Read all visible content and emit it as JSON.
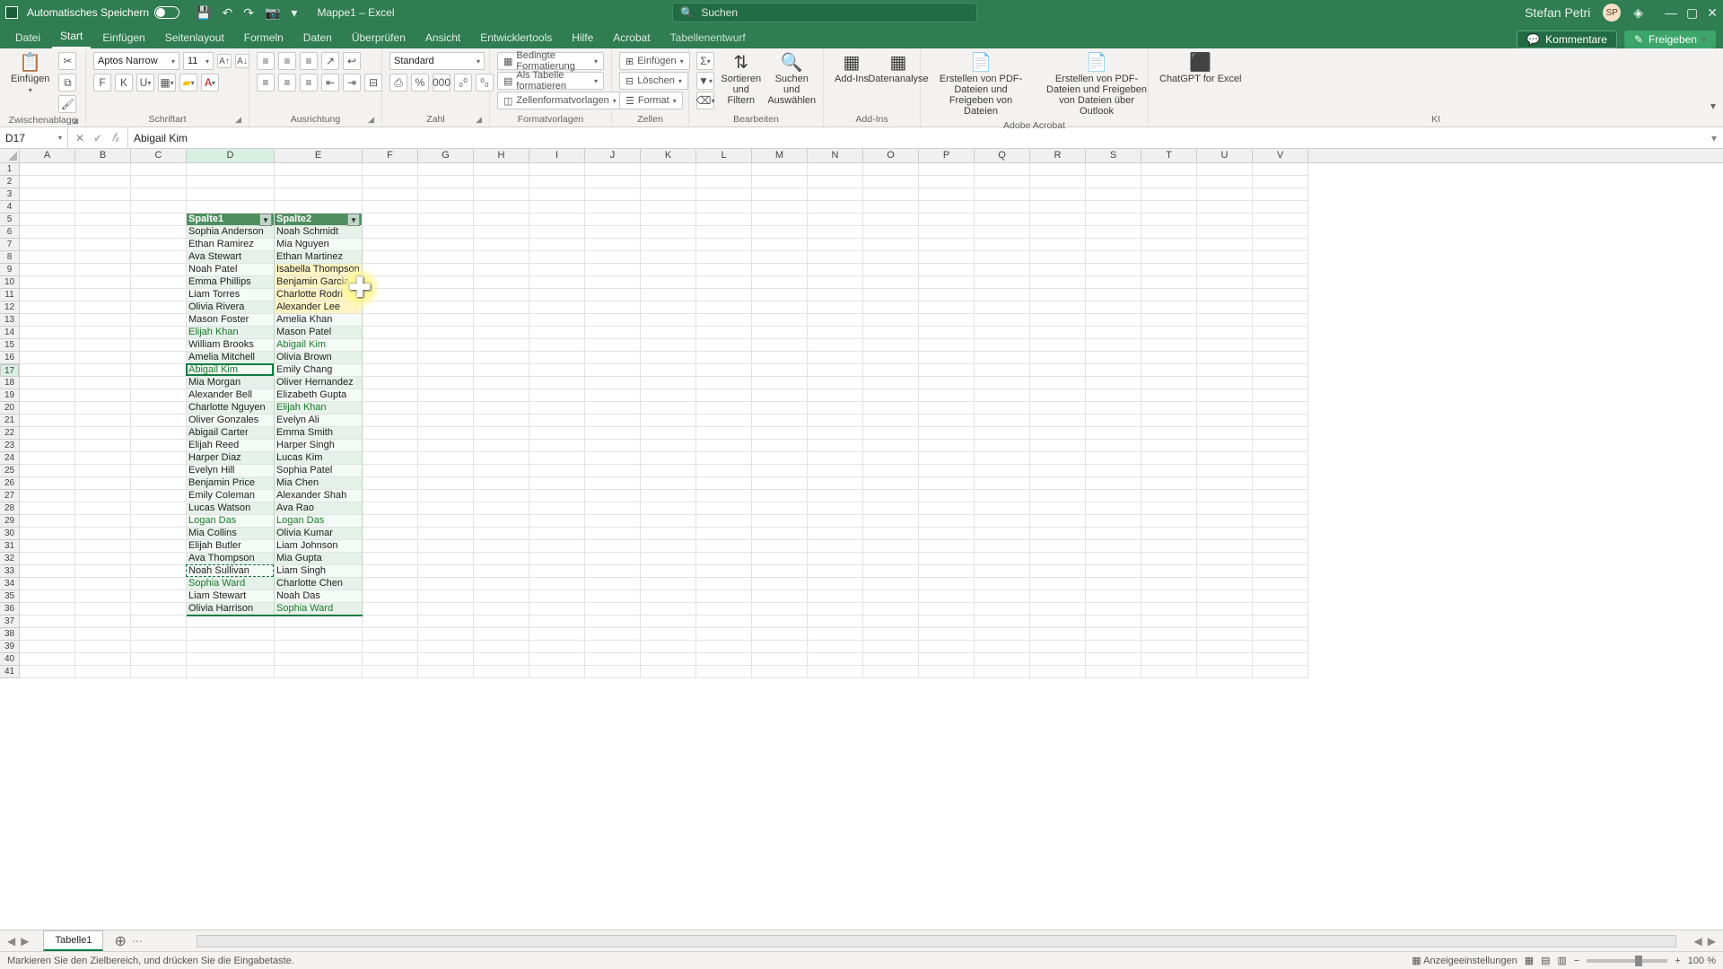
{
  "titlebar": {
    "autosave": "Automatisches Speichern",
    "title": "Mappe1 – Excel",
    "search_placeholder": "Suchen",
    "user": "Stefan Petri",
    "avatar_initials": "SP"
  },
  "tabs": {
    "items": [
      "Datei",
      "Start",
      "Einfügen",
      "Seitenlayout",
      "Formeln",
      "Daten",
      "Überprüfen",
      "Ansicht",
      "Entwicklertools",
      "Hilfe",
      "Acrobat",
      "Tabellenentwurf"
    ],
    "active_index": 1,
    "comments": "Kommentare",
    "share": "Freigeben"
  },
  "ribbon": {
    "clipboard": {
      "paste": "Einfügen",
      "label": "Zwischenablage"
    },
    "font": {
      "name": "Aptos Narrow",
      "size": "11",
      "bold": "F",
      "italic": "K",
      "underline": "U",
      "label": "Schriftart"
    },
    "alignment": {
      "label": "Ausrichtung"
    },
    "number": {
      "format": "Standard",
      "label": "Zahl"
    },
    "styles": {
      "conditional": "Bedingte Formatierung",
      "as_table": "Als Tabelle formatieren",
      "cell_styles": "Zellenformatvorlagen",
      "label": "Formatvorlagen"
    },
    "cells": {
      "insert": "Einfügen",
      "delete": "Löschen",
      "format": "Format",
      "label": "Zellen"
    },
    "editing": {
      "sort": "Sortieren und Filtern",
      "find": "Suchen und Auswählen",
      "label": "Bearbeiten"
    },
    "addins": {
      "addins": "Add-Ins",
      "analysis": "Datenanalyse",
      "label": "Add-Ins"
    },
    "acrobat": {
      "pdf": "Erstellen von PDF-Dateien und Freigeben von Dateien",
      "outlook": "Erstellen von PDF-Dateien und Freigeben von Dateien über Outlook",
      "label": "Adobe Acrobat"
    },
    "ai": {
      "chatgpt": "ChatGPT for Excel",
      "label": "KI"
    }
  },
  "formula_bar": {
    "name": "D17",
    "value": "Abigail Kim"
  },
  "columns": [
    "A",
    "B",
    "C",
    "D",
    "E",
    "F",
    "G",
    "H",
    "I",
    "J",
    "K",
    "L",
    "M",
    "N",
    "O",
    "P",
    "Q",
    "R",
    "S",
    "T",
    "U",
    "V"
  ],
  "table": {
    "header_row": 5,
    "headers": [
      "Spalte1",
      "Spalte2"
    ],
    "rows": [
      {
        "d": "Sophia Anderson",
        "e": "Noah Schmidt"
      },
      {
        "d": "Ethan Ramirez",
        "e": "Mia Nguyen"
      },
      {
        "d": "Ava Stewart",
        "e": "Ethan Martinez"
      },
      {
        "d": "Noah Patel",
        "e": "Isabella Thompson",
        "ey": true
      },
      {
        "d": "Emma Phillips",
        "e": "Benjamin Garcia",
        "ey": true
      },
      {
        "d": "Liam Torres",
        "e": "Charlotte Rodri",
        "ey": true
      },
      {
        "d": "Olivia Rivera",
        "e": "Alexander Lee",
        "ey": true
      },
      {
        "d": "Mason Foster",
        "e": "Amelia Khan"
      },
      {
        "d": "Elijah Khan",
        "e": "Mason Patel",
        "dg": true
      },
      {
        "d": "William Brooks",
        "e": "Abigail Kim",
        "eg": true
      },
      {
        "d": "Amelia Mitchell",
        "e": "Olivia Brown"
      },
      {
        "d": "Abigail Kim",
        "e": "Emily Chang",
        "dg": true
      },
      {
        "d": "Mia Morgan",
        "e": "Oliver Hernandez"
      },
      {
        "d": "Alexander Bell",
        "e": "Elizabeth Gupta"
      },
      {
        "d": "Charlotte Nguyen",
        "e": "Elijah Khan",
        "eg": true
      },
      {
        "d": "Oliver Gonzales",
        "e": "Evelyn Ali"
      },
      {
        "d": "Abigail Carter",
        "e": "Emma Smith"
      },
      {
        "d": "Elijah Reed",
        "e": "Harper Singh"
      },
      {
        "d": "Harper Diaz",
        "e": "Lucas Kim"
      },
      {
        "d": "Evelyn Hill",
        "e": "Sophia Patel"
      },
      {
        "d": "Benjamin Price",
        "e": "Mia Chen"
      },
      {
        "d": "Emily Coleman",
        "e": "Alexander Shah"
      },
      {
        "d": "Lucas Watson",
        "e": "Ava Rao"
      },
      {
        "d": "Logan Das",
        "e": "Logan Das",
        "dg": true,
        "eg": true
      },
      {
        "d": "Mia Collins",
        "e": "Olivia Kumar"
      },
      {
        "d": "Elijah Butler",
        "e": "Liam Johnson"
      },
      {
        "d": "Ava Thompson",
        "e": "Mia Gupta"
      },
      {
        "d": "Noah Sullivan",
        "e": "Liam Singh"
      },
      {
        "d": "Sophia Ward",
        "e": "Charlotte Chen",
        "dg": true
      },
      {
        "d": "Liam Stewart",
        "e": "Noah Das"
      },
      {
        "d": "Olivia Harrison",
        "e": "Sophia Ward",
        "eg": true
      }
    ]
  },
  "sheets": {
    "active": "Tabelle1"
  },
  "status": {
    "msg": "Markieren Sie den Zielbereich, und drücken Sie die Eingabetaste.",
    "accessibility": "Anzeigeeinstellungen",
    "zoom": "100 %"
  },
  "icons": {
    "save": "💾",
    "undo": "↶",
    "redo": "↷",
    "camera": "📷",
    "search": "🔍",
    "diamond": "◈",
    "min": "—",
    "max": "▢",
    "close": "✕",
    "cut": "✂",
    "copy": "⧉",
    "brush": "🖌",
    "border": "▦",
    "fill": "▰",
    "fontcolor": "A",
    "al": "≡",
    "wrap": "↩",
    "merge": "⊟",
    "orient": "↗",
    "indentm": "⇤",
    "indentp": "⇥",
    "cur": "⎙",
    "pct": "%",
    "comma": "000",
    "decM": "⁰₀",
    "decP": "₀⁰",
    "cond": "▦",
    "tbl": "▤",
    "style": "◫",
    "ins": "⊞",
    "del": "⊟",
    "fmt": "☰",
    "sum": "Σ",
    "fillH": "▼",
    "clr": "⌫",
    "sort": "⇅",
    "find": "🔍",
    "addin": "▦",
    "analy": "▦",
    "pdf": "📄",
    "gpt": "⬛",
    "chevd": "▾",
    "dots": "⋯",
    "fx": "𝑓ₓ",
    "x": "✕",
    "chk": "✓",
    "norm": "▦",
    "layout": "▤",
    "break": "▥",
    "minus": "−",
    "plus": "+"
  }
}
